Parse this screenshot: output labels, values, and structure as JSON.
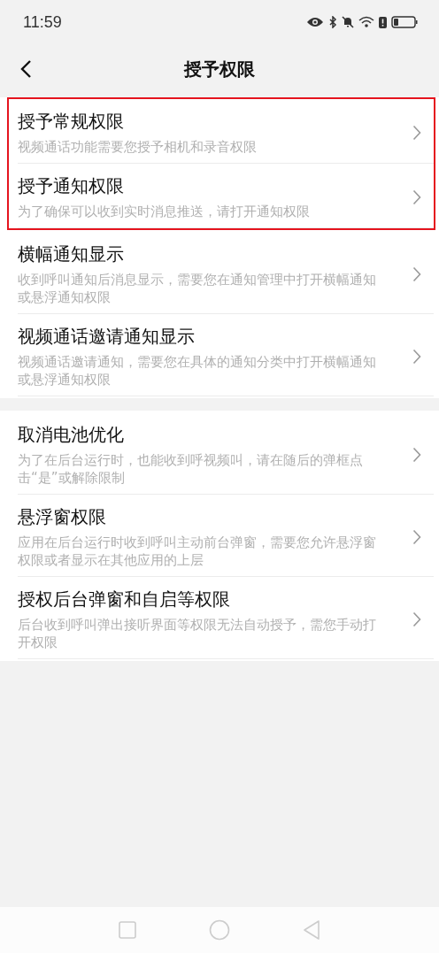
{
  "status_bar": {
    "time": "11:59"
  },
  "header": {
    "title": "授予权限"
  },
  "sections": [
    {
      "groups": [
        {
          "highlighted": true,
          "items": [
            {
              "title": "授予常规权限",
              "subtitle": "视频通话功能需要您授予相机和录音权限"
            },
            {
              "title": "授予通知权限",
              "subtitle": "为了确保可以收到实时消息推送，请打开通知权限"
            }
          ]
        },
        {
          "highlighted": false,
          "items": [
            {
              "title": "横幅通知显示",
              "subtitle": "收到呼叫通知后消息显示，需要您在通知管理中打开横幅通知或悬浮通知权限"
            },
            {
              "title": "视频通话邀请通知显示",
              "subtitle": "视频通话邀请通知，需要您在具体的通知分类中打开横幅通知或悬浮通知权限"
            }
          ]
        }
      ]
    },
    {
      "groups": [
        {
          "highlighted": false,
          "items": [
            {
              "title": "取消电池优化",
              "subtitle": "为了在后台运行时，也能收到呼视频叫，请在随后的弹框点击“是”或解除限制"
            },
            {
              "title": "悬浮窗权限",
              "subtitle": "应用在后台运行时收到呼叫主动前台弹窗，需要您允许悬浮窗权限或者显示在其他应用的上层"
            },
            {
              "title": "授权后台弹窗和自启等权限",
              "subtitle": "后台收到呼叫弹出接听界面等权限无法自动授予，需您手动打开权限"
            }
          ]
        }
      ]
    }
  ]
}
